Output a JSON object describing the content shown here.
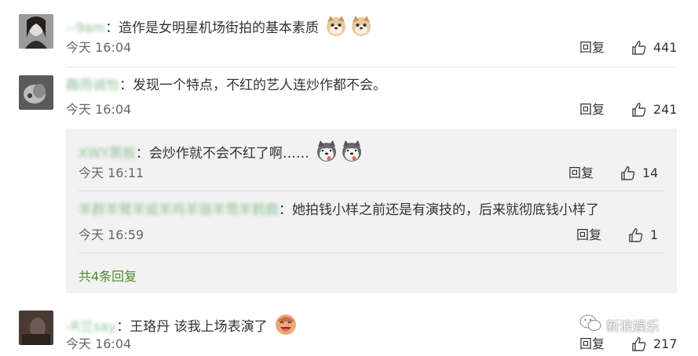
{
  "comments": [
    {
      "username": "--9am",
      "text": "：造作是女明星机场街拍的基本素质",
      "time": "今天 16:04",
      "reply_label": "回复",
      "likes": "441"
    },
    {
      "username": "趣雨诚怡",
      "text": "：发现一个特点，不红的艺人连炒作都不会。",
      "time": "今天 16:04",
      "reply_label": "回复",
      "likes": "241",
      "replies": [
        {
          "username": "XWY黑板",
          "text": "：会炒作就不会不红了啊……",
          "time": "今天 16:11",
          "reply_label": "回复",
          "likes": "14"
        },
        {
          "username": "羊群羊鹭羊或羊鸡羊宿羊莺羊鹤鹿",
          "text": "：她拍钱小样之前还是有演技的，后来就彻底钱小样了",
          "time": "今天 16:59",
          "reply_label": "回复",
          "likes": "1"
        }
      ],
      "more_replies": "共4条回复"
    },
    {
      "username": "-R兰say",
      "text": "：王珞丹 该我上场表演了",
      "time": "今天 16:04",
      "reply_label": "回复",
      "likes": "217"
    }
  ],
  "watermark": "新浪娱乐",
  "colors": {
    "username": "#8fc29a",
    "more_link": "#4d8c2e",
    "subbox_bg": "#f2f2f2"
  }
}
